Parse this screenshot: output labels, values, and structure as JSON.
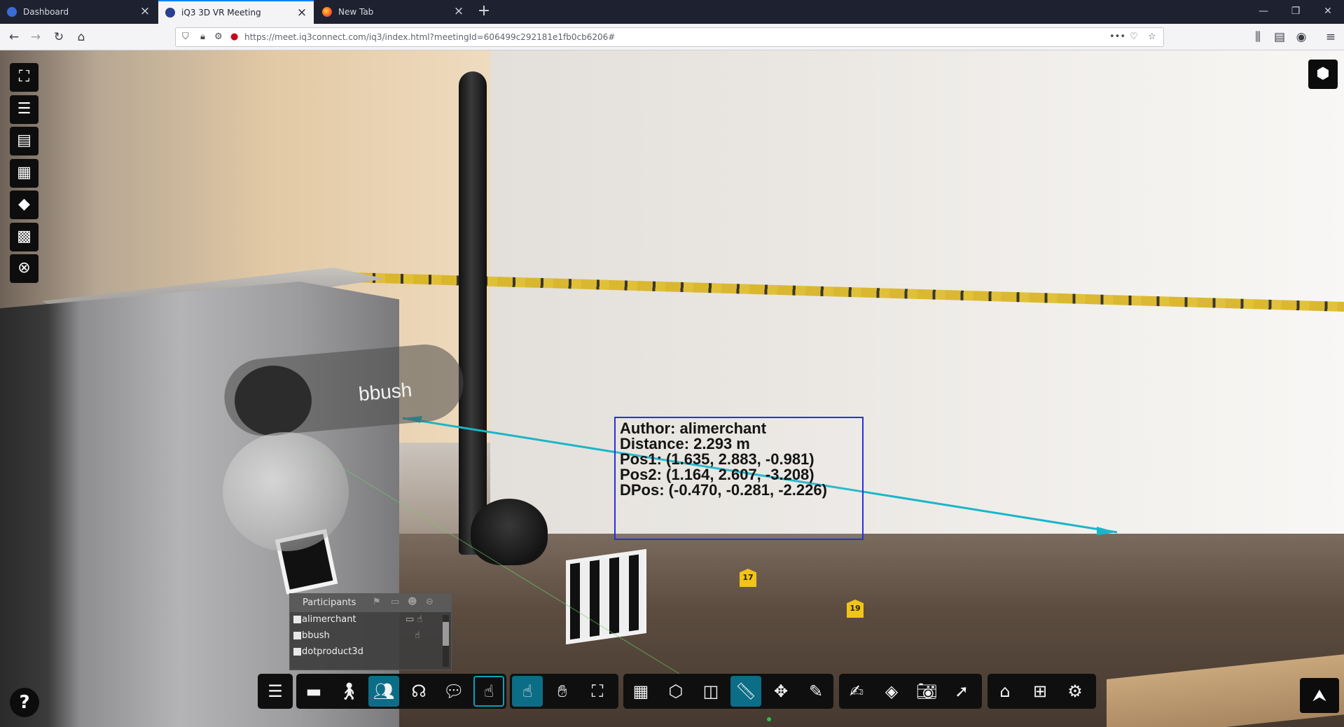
{
  "browser": {
    "tabs": [
      {
        "label": "Dashboard",
        "favicon": "dashboard-favicon",
        "active": false
      },
      {
        "label": "iQ3 3D VR Meeting",
        "favicon": "iq3-favicon",
        "active": true
      },
      {
        "label": "New Tab",
        "favicon": "firefox-favicon",
        "active": false
      }
    ],
    "new_tab_symbol": "+",
    "url": "https://meet.iq3connect.com/iq3/index.html?meetingId=606499c292181e1fb0cb6206#",
    "accent": "#0a84ff"
  },
  "viewer": {
    "avatar_label": "bbush",
    "measurement": {
      "author": "Author: alimerchant",
      "distance": "Distance: 2.293 m",
      "pos1": "Pos1: (1.635, 2.883, -0.981)",
      "pos2": "Pos2: (1.164, 2.607, -3.208)",
      "dpos": "DPos: (-0.470, -0.281, -2.226)",
      "line_color": "#19b6c9",
      "box_color": "#2d2de0"
    },
    "evidence_markers": [
      "17",
      "19"
    ],
    "participants": {
      "title": "Participants",
      "members": [
        {
          "name": "alimerchant"
        },
        {
          "name": "bbush"
        },
        {
          "name": "dotproduct3d"
        }
      ]
    },
    "left_toolbar": [
      "scene-tree-icon",
      "document-list-icon",
      "notes-icon",
      "media-icon",
      "tag-icon",
      "qr-code-icon",
      "close-icon"
    ],
    "help_label": "?",
    "bottom_toolbar": {
      "active_color": "#0c6d86",
      "groups": [
        [
          "menu-icon"
        ],
        [
          "vr-headset-icon",
          "walk-icon",
          "participants-icon",
          "presenter-icon",
          "add-comment-icon",
          "touch-icon"
        ],
        [
          "select-hand-icon",
          "grab-hand-icon",
          "fullscreen-icon"
        ],
        [
          "layers-icon",
          "cube-icon",
          "section-box-icon",
          "measure-ruler-icon",
          "move-icon",
          "draw-pen-icon"
        ],
        [
          "annotate-icon",
          "tag-icon",
          "camera-icon",
          "pointer-icon"
        ],
        [
          "home-icon",
          "grid-view-icon",
          "settings-icon"
        ]
      ]
    }
  }
}
